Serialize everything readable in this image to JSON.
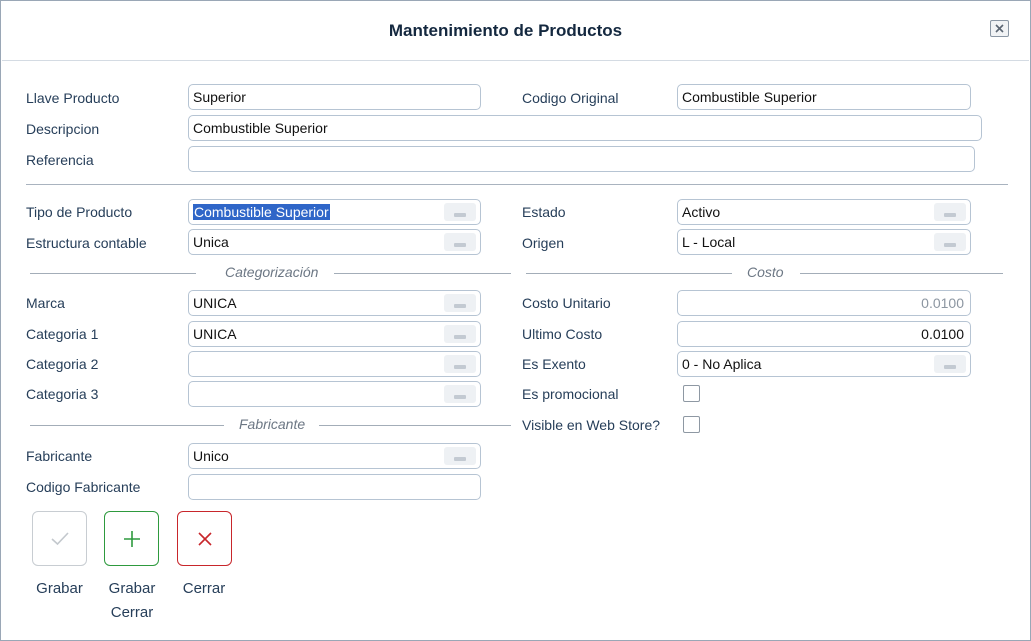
{
  "dialog": {
    "title": "Mantenimiento de Productos",
    "close_icon": "close-icon"
  },
  "fields": {
    "llave_producto": {
      "label": "Llave Producto",
      "value": "Superior"
    },
    "codigo_original": {
      "label": "Codigo Original",
      "value": "Combustible Superior"
    },
    "descripcion": {
      "label": "Descripcion",
      "value": "Combustible Superior"
    },
    "referencia": {
      "label": "Referencia",
      "value": ""
    },
    "tipo_producto": {
      "label": "Tipo de Producto",
      "value": "Combustible Superior"
    },
    "estado": {
      "label": "Estado",
      "value": "Activo"
    },
    "estructura_contable": {
      "label": "Estructura contable",
      "value": "Unica"
    },
    "origen": {
      "label": "Origen",
      "value": "L - Local"
    },
    "marca": {
      "label": "Marca",
      "value": "UNICA"
    },
    "costo_unitario": {
      "label": "Costo Unitario",
      "value": "0.0100"
    },
    "categoria_1": {
      "label": "Categoria 1",
      "value": "UNICA"
    },
    "ultimo_costo": {
      "label": "Ultimo Costo",
      "value": "0.0100"
    },
    "categoria_2": {
      "label": "Categoria 2",
      "value": ""
    },
    "es_exento": {
      "label": "Es Exento",
      "value": "0 - No Aplica"
    },
    "categoria_3": {
      "label": "Categoria 3",
      "value": ""
    },
    "es_promocional": {
      "label": "Es promocional",
      "checked": false
    },
    "visible_web_store": {
      "label": "Visible en Web Store?",
      "checked": false
    },
    "fabricante": {
      "label": "Fabricante",
      "value": "Unico"
    },
    "codigo_fabricante": {
      "label": "Codigo Fabricante",
      "value": ""
    }
  },
  "sections": {
    "categorizacion": "Categorización",
    "costo": "Costo",
    "fabricante": "Fabricante"
  },
  "actions": {
    "grabar": {
      "label": "Grabar",
      "icon": "check-icon",
      "color": "#c8cdd2"
    },
    "grabar_cerrar": {
      "label_line1": "Grabar",
      "label_line2": "Cerrar",
      "icon": "plus-icon",
      "color": "#2e9a3e"
    },
    "cerrar": {
      "label": "Cerrar",
      "icon": "x-icon",
      "color": "#c8262b"
    }
  }
}
